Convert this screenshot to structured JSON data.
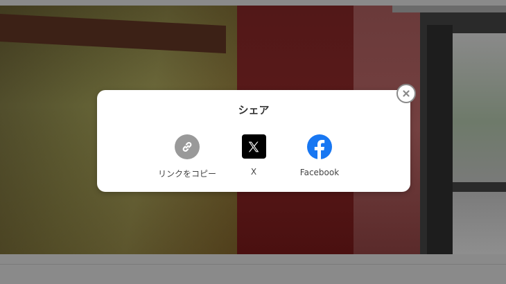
{
  "modal": {
    "title": "シェア"
  },
  "share_options": [
    {
      "label": "リンクをコピー",
      "icon": "link-icon",
      "color": "#999999"
    },
    {
      "label": "X",
      "icon": "x-logo-icon",
      "color": "#000000"
    },
    {
      "label": "Facebook",
      "icon": "facebook-icon",
      "color": "#1877f2"
    }
  ],
  "close": {
    "icon": "close-icon"
  }
}
